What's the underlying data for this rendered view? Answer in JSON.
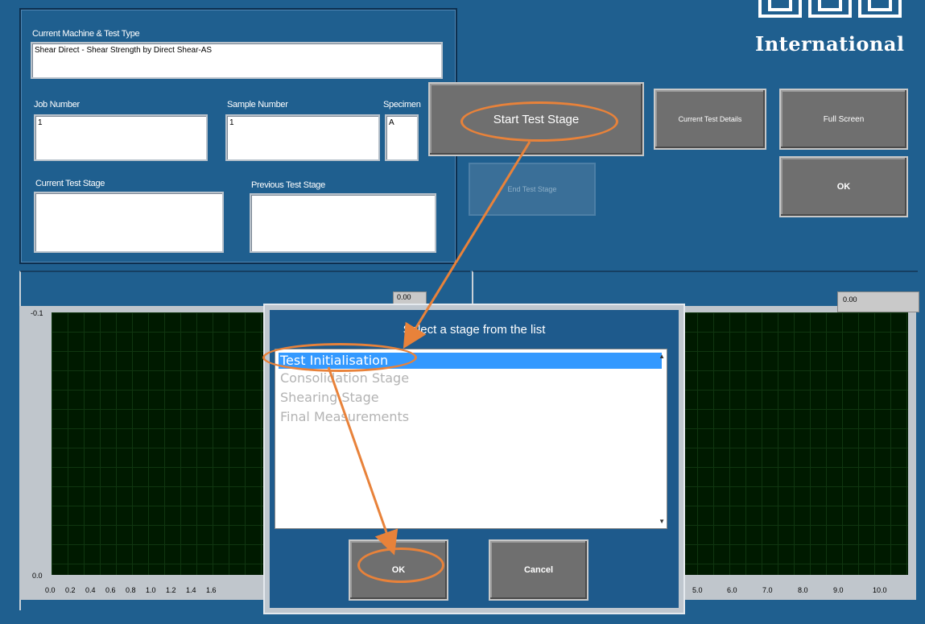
{
  "brand": {
    "name": "International"
  },
  "machine": {
    "label": "Current Machine & Test Type",
    "value": "Shear Direct   -   Shear Strength by Direct Shear-AS"
  },
  "job": {
    "label": "Job Number",
    "value": "1"
  },
  "sample": {
    "label": "Sample Number",
    "value": "1"
  },
  "specimen": {
    "label": "Specimen",
    "value": "A"
  },
  "current_stage": {
    "label": "Current Test Stage",
    "value": ""
  },
  "previous_stage": {
    "label": "Previous Test Stage",
    "value": ""
  },
  "buttons": {
    "start": "Start Test Stage",
    "end": "End Test Stage",
    "details": "Current Test Details",
    "fullscreen": "Full Screen",
    "ok": "OK"
  },
  "left_graph": {
    "readout": "0.00",
    "y_ticks": [
      "-0.1",
      "0.0"
    ],
    "x_ticks": [
      "0.0",
      "0.2",
      "0.4",
      "0.6",
      "0.8",
      "1.0",
      "1.2",
      "1.4",
      "1.6"
    ]
  },
  "right_graph": {
    "readout": "0.00",
    "x_ticks": [
      "5.0",
      "6.0",
      "7.0",
      "8.0",
      "9.0",
      "10.0"
    ]
  },
  "dialog": {
    "title": "Select a stage from the list",
    "items": [
      "Test Initialisation",
      "Consolidation Stage",
      "Shearing Stage",
      "Final Measurements"
    ],
    "selected_index": 0,
    "ok": "OK",
    "cancel": "Cancel"
  },
  "colors": {
    "background": "#1f5f8f",
    "highlight": "#e8823a",
    "selection": "#3399ff"
  }
}
